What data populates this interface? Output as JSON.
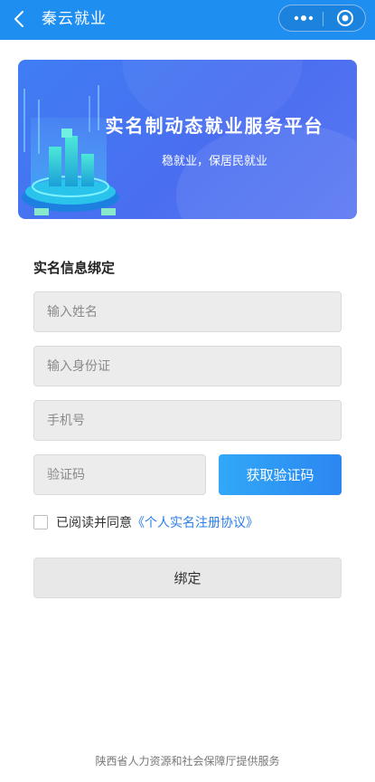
{
  "header": {
    "title": "秦云就业",
    "background": "#1e8ef0",
    "back_icon": "chevron-left-icon",
    "more_icon": "more-dots-icon",
    "close_icon": "target-icon"
  },
  "banner": {
    "title": "实名制动态就业服务平台",
    "subtitle": "稳就业，保居民就业"
  },
  "form": {
    "section_title": "实名信息绑定",
    "name_placeholder": "输入姓名",
    "id_placeholder": "输入身份证",
    "phone_placeholder": "手机号",
    "code_placeholder": "验证码",
    "get_code_label": "获取验证码",
    "agree_prefix": "已阅读并同意",
    "agree_link": "《个人实名注册协议》",
    "submit_label": "绑定",
    "accent": "#2a7ee8"
  },
  "footer": {
    "text": "陕西省人力资源和社会保障厅提供服务"
  }
}
